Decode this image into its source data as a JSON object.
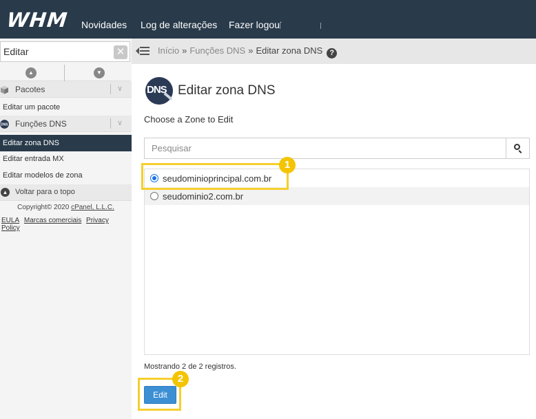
{
  "header": {
    "logo": "WHM",
    "nav": [
      "Novidades",
      "Log de alterações",
      "Fazer logout"
    ]
  },
  "sidebar": {
    "search_value": "Editar",
    "clear_glyph": "✕",
    "collapse_up_glyph": "▲",
    "collapse_down_glyph": "▼",
    "categories": [
      {
        "label": "Pacotes",
        "toggle": "∨",
        "icon": "package-icon"
      },
      {
        "label": "Funções DNS",
        "toggle": "∨",
        "icon": "dns-icon"
      }
    ],
    "items": [
      {
        "label": "Editar um pacote",
        "active": false
      },
      {
        "label": "Editar zona DNS",
        "active": true
      },
      {
        "label": "Editar entrada MX",
        "active": false
      },
      {
        "label": "Editar modelos de zona",
        "active": false
      }
    ],
    "back_to_top": "Voltar para o topo",
    "copyright_prefix": "Copyright© 2020",
    "copyright_link": "cPanel, L.L.C.",
    "footer_links": [
      "EULA",
      "Marcas comerciais",
      "Privacy Policy"
    ]
  },
  "breadcrumb": {
    "items": [
      "Início",
      "Funções DNS",
      "Editar zona DNS"
    ],
    "separator": "»",
    "help_glyph": "?"
  },
  "main": {
    "icon_text": "DNS",
    "title": "Editar zona DNS",
    "subtitle": "Choose a Zone to Edit",
    "search_placeholder": "Pesquisar",
    "zones": [
      {
        "label": "seudominioprincipal.com.br",
        "checked": true
      },
      {
        "label": "seudominio2.com.br",
        "checked": false
      }
    ],
    "showing": "Mostrando 2 de 2 registros.",
    "edit_label": "Edit"
  },
  "annotations": [
    "1",
    "2"
  ],
  "colors": {
    "topbar": "#293a4a",
    "active_item": "#293a4a",
    "primary_button": "#3d8fd4",
    "callout": "#f5cf2d",
    "badge": "#f5c400"
  }
}
